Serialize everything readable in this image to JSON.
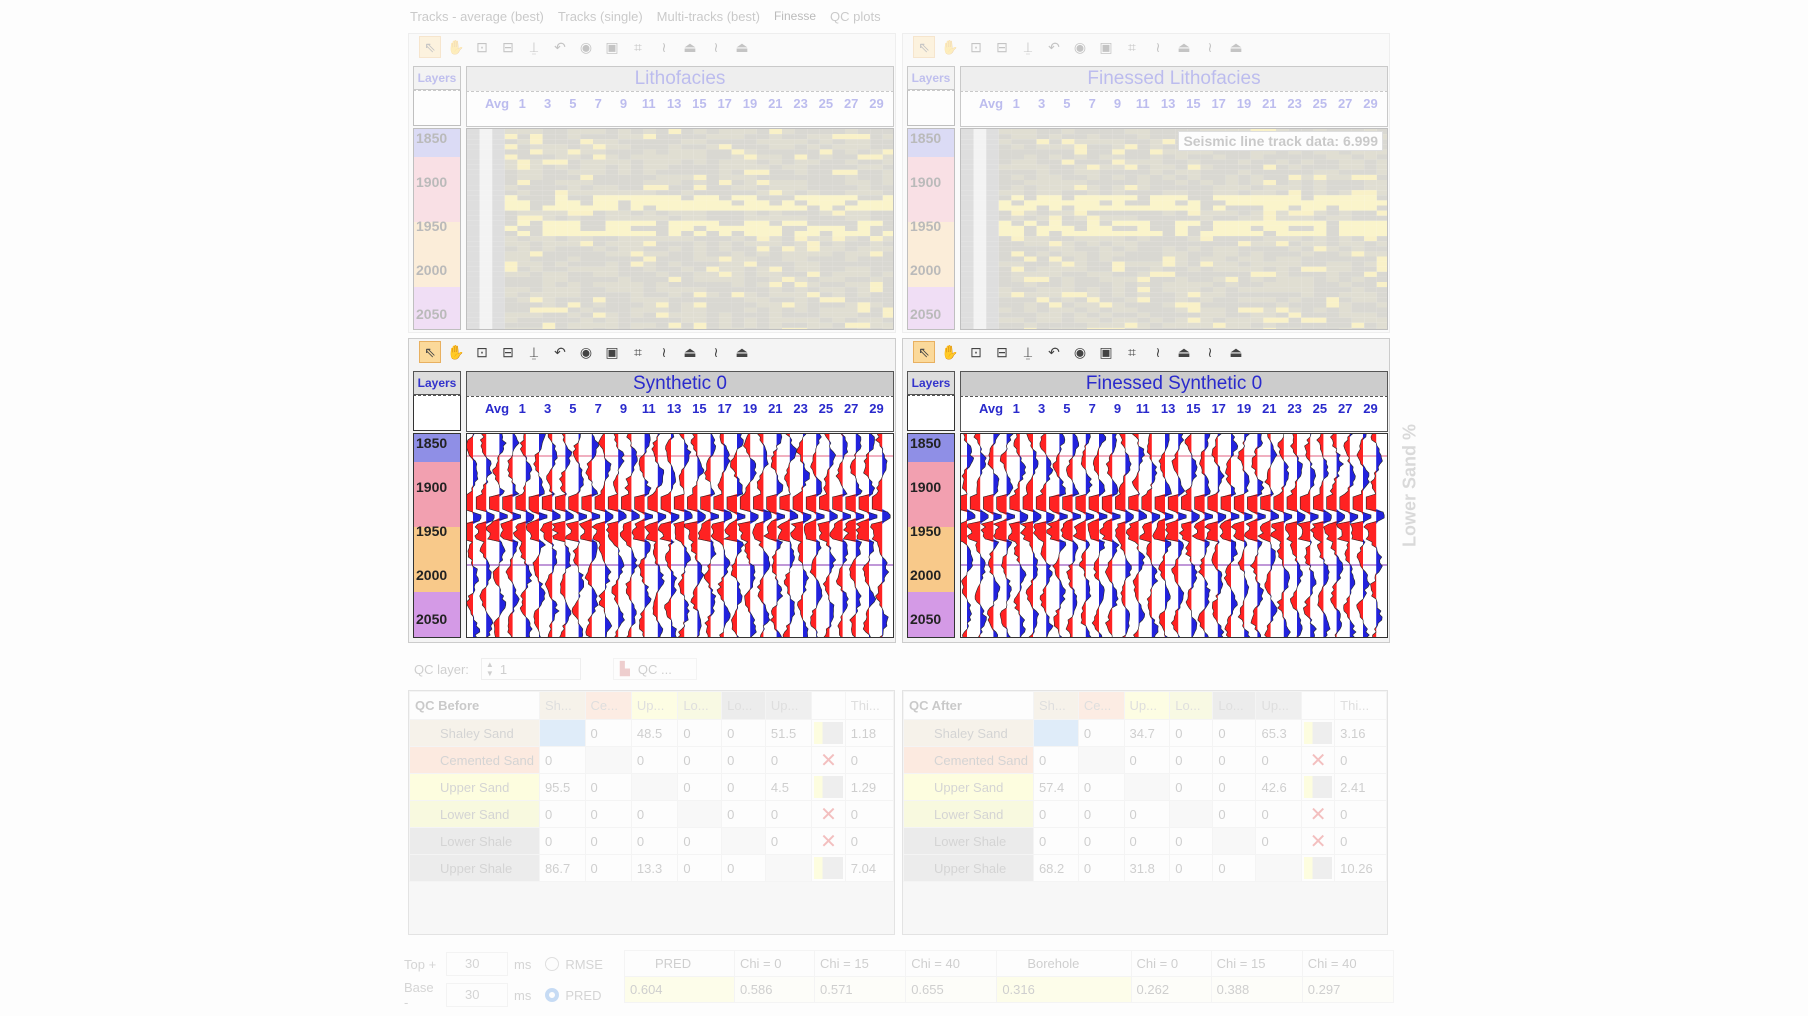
{
  "tabs": [
    "Tracks - average (best)",
    "Tracks (single)",
    "Multi-tracks (best)",
    "Finesse",
    "QC plots"
  ],
  "active_tab": "Finesse",
  "track_labels": [
    "Avg",
    "1",
    "3",
    "5",
    "7",
    "9",
    "11",
    "13",
    "15",
    "17",
    "19",
    "21",
    "23",
    "25",
    "27",
    "29"
  ],
  "depths": [
    "1850",
    "1900",
    "1950",
    "2000",
    "2050"
  ],
  "layers_label": "Layers",
  "panels": {
    "top_left": {
      "title": "Lithofacies"
    },
    "top_right": {
      "title": "Finessed Lithofacies",
      "tooltip": "Seismic line track data: 6.999"
    },
    "mid_left": {
      "title": "Synthetic 0"
    },
    "mid_right": {
      "title": "Finessed Synthetic 0"
    }
  },
  "side_label": "Lower Sand %",
  "layer_colors": {
    "blue": "#8f8fe6",
    "pink": "#f2a0b0",
    "orange": "#f8c98a",
    "purple": "#d49ae6"
  },
  "wiggle_colors": {
    "positive": "#ff2222",
    "negative": "#2222dd"
  },
  "qc_layer": {
    "label": "QC layer:",
    "value": "1",
    "qc_button": "QC ..."
  },
  "qc_columns": [
    "Sh...",
    "Ce...",
    "Up...",
    "Lo...",
    "Lo...",
    "Up...",
    "",
    "Thi..."
  ],
  "qc_column_colors": [
    "#e8dcc0",
    "#fcc8a8",
    "#ffffa8",
    "#eef0a8",
    "#c8c8c8",
    "#d0d0d0",
    "#fff",
    "#fff"
  ],
  "qc_rows": [
    {
      "name": "Shaley Sand",
      "color": "#e8dcc0"
    },
    {
      "name": "Cemented Sand",
      "color": "#fcc0a0"
    },
    {
      "name": "Upper Sand",
      "color": "#ffff9c"
    },
    {
      "name": "Lower Sand",
      "color": "#eef09c"
    },
    {
      "name": "Lower Shale",
      "color": "#c4c4c4"
    },
    {
      "name": "Upper Shale",
      "color": "#c8c8c8"
    }
  ],
  "qc_before": {
    "title": "QC Before",
    "values": [
      [
        "",
        "0",
        "48.5",
        "0",
        "0",
        "51.5",
        "bar",
        "1.18"
      ],
      [
        "0",
        "",
        "0",
        "0",
        "0",
        "0",
        "x",
        "0"
      ],
      [
        "95.5",
        "0",
        "",
        "0",
        "0",
        "4.5",
        "bar",
        "1.29"
      ],
      [
        "0",
        "0",
        "0",
        "",
        "0",
        "0",
        "x",
        "0"
      ],
      [
        "0",
        "0",
        "0",
        "0",
        "",
        "0",
        "x",
        "0"
      ],
      [
        "86.7",
        "0",
        "13.3",
        "0",
        "0",
        "",
        "bar",
        "7.04"
      ]
    ]
  },
  "qc_after": {
    "title": "QC After",
    "values": [
      [
        "",
        "0",
        "34.7",
        "0",
        "0",
        "65.3",
        "bar",
        "3.16"
      ],
      [
        "0",
        "",
        "0",
        "0",
        "0",
        "0",
        "x",
        "0"
      ],
      [
        "57.4",
        "0",
        "",
        "0",
        "0",
        "42.6",
        "bar",
        "2.41"
      ],
      [
        "0",
        "0",
        "0",
        "",
        "0",
        "0",
        "x",
        "0"
      ],
      [
        "0",
        "0",
        "0",
        "0",
        "",
        "0",
        "x",
        "0"
      ],
      [
        "68.2",
        "0",
        "31.8",
        "0",
        "0",
        "",
        "bar",
        "10.26"
      ]
    ]
  },
  "bottom": {
    "top_label": "Top +",
    "top_value": "30",
    "base_label": "Base -",
    "base_value": "30",
    "unit": "ms",
    "radio_rmse": "RMSE",
    "radio_pred": "PRED",
    "selected": "PRED",
    "headers": [
      "PRED",
      "Chi = 0",
      "Chi = 15",
      "Chi = 40",
      "Borehole",
      "Chi = 0",
      "Chi = 15",
      "Chi = 40"
    ],
    "values": [
      "0.604",
      "0.586",
      "0.571",
      "0.655",
      "0.316",
      "0.262",
      "0.388",
      "0.297"
    ]
  }
}
